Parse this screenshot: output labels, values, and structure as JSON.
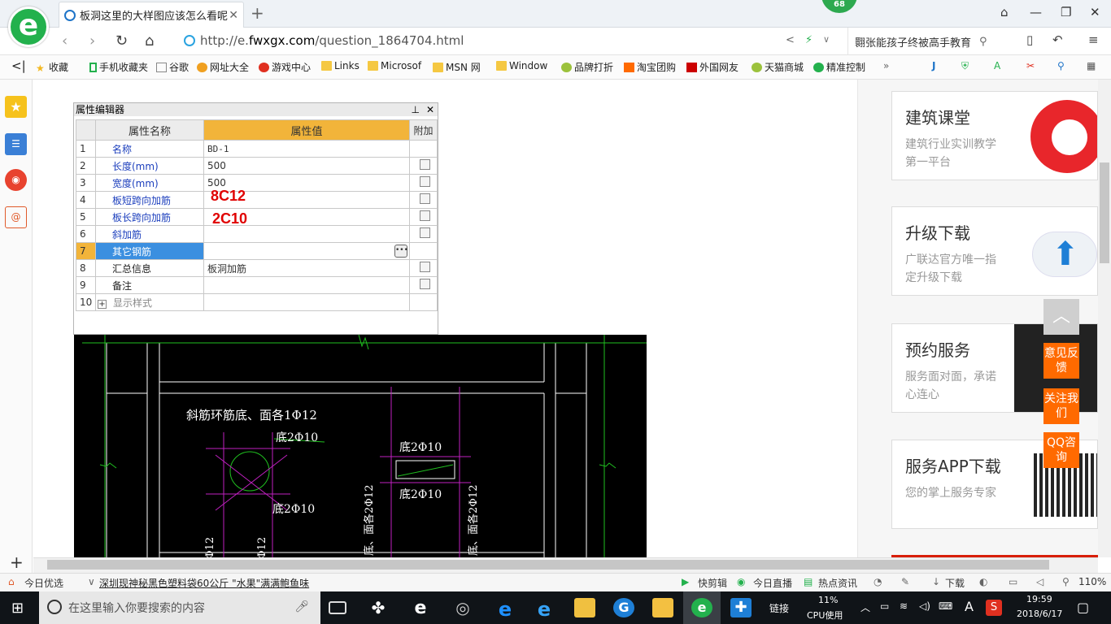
{
  "browser": {
    "tab_title": "板洞这里的大样图应该怎么看呢",
    "badge_count": "68",
    "url_prefix": "http://e.",
    "url_domain": "fwxgx.com",
    "url_path": "/question_1864704.html",
    "search_text": "翾张能孩子终被高手教育"
  },
  "bookmarks": [
    "收藏",
    "手机收藏夹",
    "谷歌",
    "网址大全",
    "游戏中心",
    "Links",
    "Microsof",
    "MSN 网",
    "Window",
    "品牌打折",
    "淘宝团购",
    "外国网友",
    "天猫商城",
    "精准控制"
  ],
  "property_editor": {
    "title": "属性编辑器",
    "col_name": "属性名称",
    "col_value": "属性值",
    "col_extra": "附加",
    "rows": [
      {
        "n": "1",
        "name": "名称",
        "value": "BD-1"
      },
      {
        "n": "2",
        "name": "长度(mm)",
        "value": "500"
      },
      {
        "n": "3",
        "name": "宽度(mm)",
        "value": "500"
      },
      {
        "n": "4",
        "name": "板短跨向加筋",
        "value": ""
      },
      {
        "n": "5",
        "name": "板长跨向加筋",
        "value": ""
      },
      {
        "n": "6",
        "name": "斜加筋",
        "value": ""
      },
      {
        "n": "7",
        "name": "其它钢筋",
        "value": ""
      },
      {
        "n": "8",
        "name": "汇总信息",
        "value": "板洞加筋"
      },
      {
        "n": "9",
        "name": "备注",
        "value": ""
      },
      {
        "n": "10",
        "name": "显示样式",
        "value": ""
      }
    ],
    "annotation_1": "8C12",
    "annotation_2": "2C10"
  },
  "cad": {
    "label_1": "斜筋环筋底、面各1Φ12",
    "label_2": "底2Φ10",
    "label_3": "底2Φ10",
    "label_4": "底2Φ10",
    "label_5": "底2Φ10",
    "label_6": "底、面各2Φ12",
    "label_7": "底、面各2Φ12",
    "label_8": "Φ12",
    "label_9": "Φ12"
  },
  "right_cards": [
    {
      "title": "建筑课堂",
      "desc": "建筑行业实训教学第一平台"
    },
    {
      "title": "升级下载",
      "desc": "广联达官方唯一指定升级下载"
    },
    {
      "title": "预约服务",
      "desc": "服务面对面，承诺心连心"
    },
    {
      "title": "服务APP下载",
      "desc": "您的掌上服务专家"
    }
  ],
  "float_buttons": [
    "意见反馈",
    "关注我们",
    "QQ咨询"
  ],
  "status_bar": {
    "left1": "今日优选",
    "news": "深圳现神秘黑色塑料袋60公斤 \"水果\"满满鲍鱼味",
    "items": [
      "快剪辑",
      "今日直播",
      "热点资讯",
      "下载"
    ],
    "zoom": "110%"
  },
  "taskbar": {
    "search_placeholder": "在这里输入你要搜索的内容",
    "link_label": "链接",
    "cpu_pct": "11%",
    "cpu_label": "CPU使用",
    "ime": "A",
    "time": "19:59",
    "date": "2018/6/17"
  },
  "colors": {
    "accent": "#ff6a00",
    "green": "#23b14d",
    "header_orange": "#f2b43a",
    "cad_magenta": "#c020c0",
    "cad_green": "#20c020"
  }
}
